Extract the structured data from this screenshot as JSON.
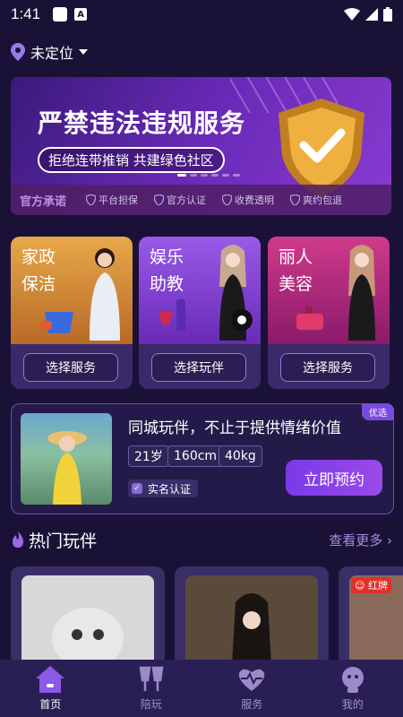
{
  "status": {
    "time": "1:41",
    "notif_letter": "A"
  },
  "location": {
    "label": "未定位"
  },
  "banner": {
    "title": "严禁违法违规服务",
    "subtitle": "拒绝连带推销 共建绿色社区"
  },
  "promise": {
    "title": "官方承诺",
    "items": [
      "平台担保",
      "官方认证",
      "收费透明",
      "爽约包退"
    ]
  },
  "services": [
    {
      "label": "家政保洁",
      "button": "选择服务"
    },
    {
      "label": "娱乐助教",
      "button": "选择玩伴"
    },
    {
      "label": "丽人美容",
      "button": "选择服务"
    }
  ],
  "featured": {
    "tag": "优选",
    "title": "同城玩伴，不止于提供情绪价值",
    "pills": [
      "21岁",
      "160cm",
      "40kg"
    ],
    "verified": "实名认证",
    "book": "立即预约"
  },
  "hot": {
    "title": "热门玩伴",
    "more": "查看更多",
    "red_tag": "红牌"
  },
  "tabs": [
    {
      "label": "首页",
      "icon": "home-icon"
    },
    {
      "label": "陪玩",
      "icon": "cheers-icon"
    },
    {
      "label": "服务",
      "icon": "heart-pulse-icon"
    },
    {
      "label": "我的",
      "icon": "profile-icon"
    }
  ],
  "colors": {
    "bg": "#1a1236",
    "accent": "#8a4ae8",
    "tabbar": "#2a1f55"
  }
}
